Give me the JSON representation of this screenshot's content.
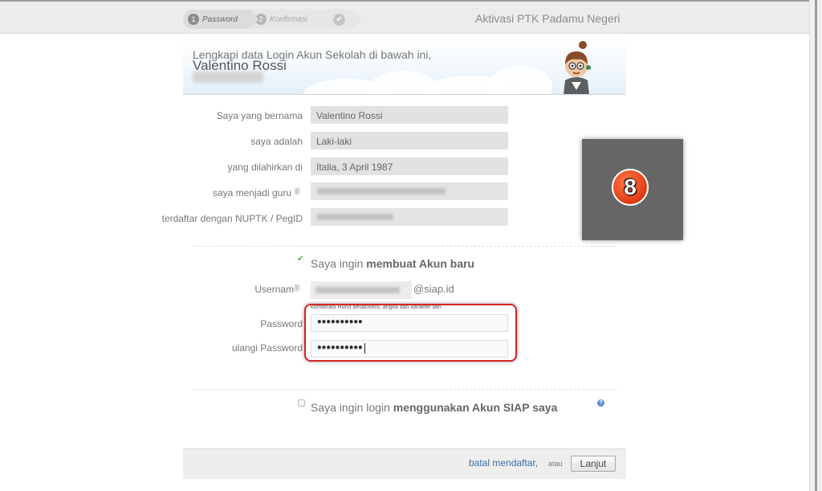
{
  "app_title": "Aktivasi PTK Padamu Negeri",
  "steps": [
    {
      "num": "1",
      "label": "Password"
    },
    {
      "num": "2",
      "label": "Konfirmasi"
    },
    {
      "icon": "check-icon"
    }
  ],
  "banner": {
    "line1": "Lengkapi data Login Akun Sekolah di bawah ini,",
    "name": "Valentino Rossi"
  },
  "profile": {
    "name_label": "Saya yang bernama",
    "name_value": "Valentino Rossi",
    "gender_label": "saya adalah",
    "gender_value": "Laki-laki",
    "birth_label": "yang dilahirkan di",
    "birth_value": "Italia, 3 April 1987",
    "teacher_label": "saya menjadi guru",
    "nuptk_label": "terdaftar dengan NUPTK / PegID"
  },
  "photo_badge": "8",
  "create_account": {
    "prefix": "Saya ingin",
    "bold": "membuat Akun baru",
    "checked": true
  },
  "username_label": "Usernam",
  "username_suffix": "@siap.id",
  "password_hint": "kombinasi Huruf besar/kecil, angka dan karakter lain",
  "password_label": "Password",
  "password_value": "••••••••••",
  "repeat_label": "ulangi Password",
  "repeat_value": "••••••••••",
  "siap_login": {
    "prefix": "Saya ingin login",
    "bold": "menggunakan Akun SIAP saya",
    "checked": false
  },
  "help_icon_char": "?",
  "footer": {
    "cancel_label": "batal mendaftar,",
    "or_label": "atau",
    "next_label": "Lanjut"
  },
  "colors": {
    "highlight": "#d32626",
    "link": "#3a6fa8",
    "checked_green": "#5fae3c"
  }
}
